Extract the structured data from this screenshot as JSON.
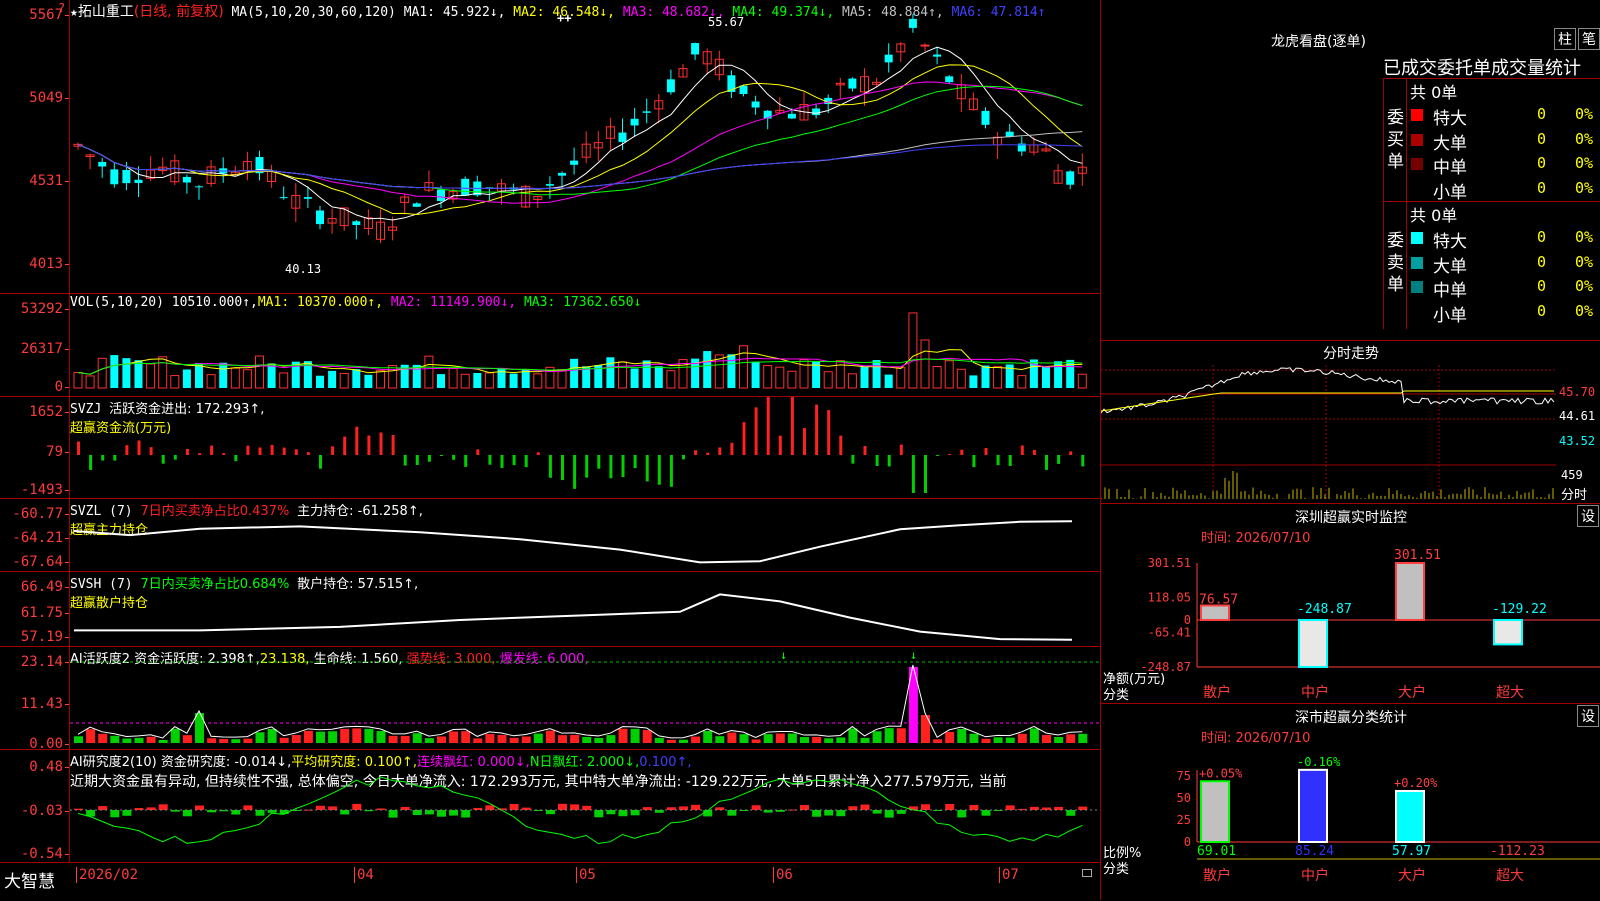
{
  "corner_mark": "?",
  "main": {
    "star": "★",
    "stock_name": "拓山重工",
    "period": "(日线, 前复权)",
    "ma_label": "MA(5,10,20,30,60,120)",
    "ma": [
      {
        "label": "MA1: 45.922↓,",
        "color": "#ffffff"
      },
      {
        "label": "MA2: 46.548↓,",
        "color": "#ffff00"
      },
      {
        "label": "MA3: 48.682↓,",
        "color": "#ff00ff"
      },
      {
        "label": "MA4: 49.374↓,",
        "color": "#00ff00"
      },
      {
        "label": "MA5: 48.884↑,",
        "color": "#c0c0c0"
      },
      {
        "label": "MA6: 47.814↑",
        "color": "#4040ff"
      }
    ],
    "y_ticks": [
      "5567",
      "5049",
      "4531",
      "4013"
    ],
    "high_marker": "55.67",
    "low_marker": "40.13",
    "plus_marker": "++"
  },
  "vol": {
    "label": "VOL(5,10,20)",
    "value": "10510.000↑,",
    "ma": [
      {
        "label": "MA1: 10370.000↑,",
        "color": "#ffff00"
      },
      {
        "label": "MA2: 11149.900↓,",
        "color": "#ff00ff"
      },
      {
        "label": "MA3: 17362.650↓",
        "color": "#00ff00"
      }
    ],
    "y_ticks": [
      "53292",
      "26317",
      "0"
    ]
  },
  "svzj": {
    "label": "SVZJ",
    "line1": "活跃资金进出: 172.293↑,",
    "line2": "超赢资金流(万元)",
    "y_ticks": [
      "1652",
      "79",
      "-1493"
    ]
  },
  "svzl": {
    "label": "SVZL (7)",
    "red": "7日内买卖净占比0.437%",
    "white": "主力持仓: -61.258↑,",
    "line2": "超赢主力持仓",
    "y_ticks": [
      "-60.77",
      "-64.21",
      "-67.64"
    ]
  },
  "svsh": {
    "label": "SVSH (7)",
    "green": "7日内买卖净占比0.684%",
    "white": "散户持仓: 57.515↑,",
    "line2": "超赢散户持仓",
    "y_ticks": [
      "66.49",
      "61.75",
      "57.19"
    ]
  },
  "ai1": {
    "label": "AI活跃度2",
    "white": "资金活跃度: 2.398↑,",
    "yellow": "23.138,",
    "life": "生命线: 1.560,",
    "strong": "强势线: 3.000,",
    "burst": "爆发线: 6.000,",
    "y_ticks": [
      "23.14",
      "11.43",
      "0.00"
    ]
  },
  "ai2": {
    "label": "AI研究度2(10)",
    "white": "资金研究度: -0.014↓,",
    "yellow": "平均研究度: 0.100↑,",
    "magenta": "连续飘红: 0.000↓,",
    "green": "N日飘红: 2.000↓,",
    "blue": "0.100↑,",
    "comment": "近期大资金虽有异动, 但持续性不强, 总体偏空, 今日大单净流入: 172.293万元, 其中特大单净流出: -129.22万元, 大单5日累计净入277.579万元, 当前",
    "y_ticks": [
      "0.48",
      "-0.03",
      "-0.54"
    ]
  },
  "xaxis": {
    "brand": "大智慧",
    "labels": [
      "2026/02",
      "04",
      "05",
      "06",
      "07"
    ]
  },
  "dragon": {
    "title": "龙虎看盘(逐单)",
    "btn1": "柱",
    "btn2": "笔",
    "subtitle": "已成交委托单成交量统计",
    "buy": {
      "side_label": "委买单",
      "count": "共 0单",
      "rows": [
        {
          "name": "特大",
          "color": "#ff0000",
          "val": "0",
          "pct": "0%"
        },
        {
          "name": "大单",
          "color": "#aa0000",
          "val": "0",
          "pct": "0%"
        },
        {
          "name": "中单",
          "color": "#770000",
          "val": "0",
          "pct": "0%"
        },
        {
          "name": "小单",
          "color": "",
          "val": "0",
          "pct": "0%"
        }
      ]
    },
    "sell": {
      "side_label": "委卖单",
      "count": "共 0单",
      "rows": [
        {
          "name": "特大",
          "color": "#00ffff",
          "val": "0",
          "pct": "0%"
        },
        {
          "name": "大单",
          "color": "#00a0a0",
          "val": "0",
          "pct": "0%"
        },
        {
          "name": "中单",
          "color": "#008080",
          "val": "0",
          "pct": "0%"
        },
        {
          "name": "小单",
          "color": "",
          "val": "0",
          "pct": "0%"
        }
      ]
    }
  },
  "intraday": {
    "title": "分时走势",
    "y_ticks": [
      "45.70",
      "44.61",
      "43.52"
    ],
    "vol_tick": "459",
    "vol_label": "分时"
  },
  "sz_monitor": {
    "title": "深圳超赢实时监控",
    "btn": "设",
    "time": "时间: 2026/07/10",
    "y_ticks": [
      "301.51",
      "118.05",
      "0",
      "-65.41",
      "-248.87"
    ],
    "ylabel1": "净额(万元)",
    "ylabel2": "分类",
    "chart_data": {
      "type": "bar",
      "categories": [
        "散户",
        "中户",
        "大户",
        "超大"
      ],
      "values": [
        76.57,
        -248.87,
        301.51,
        -129.22
      ],
      "value_labels": [
        "76.57",
        "-248.87",
        "301.51",
        "-129.22"
      ],
      "ylim": [
        -248.87,
        301.51
      ]
    }
  },
  "sz_class": {
    "title": "深市超赢分类统计",
    "btn": "设",
    "time": "时间: 2026/07/10",
    "y_ticks": [
      "75",
      "50",
      "25",
      "0"
    ],
    "ylabel1": "比例%",
    "ylabel2": "分类",
    "chart_data": {
      "type": "bar",
      "categories": [
        "散户",
        "中户",
        "大户",
        "超大"
      ],
      "values": [
        69.01,
        85.24,
        57.97,
        -112.23
      ],
      "value_labels": [
        "69.01",
        "85.24",
        "57.97",
        "-112.23"
      ],
      "change_labels": [
        "+0.05%",
        "-0.16%",
        "+0.20%",
        ""
      ],
      "ylim": [
        0,
        75
      ]
    }
  }
}
